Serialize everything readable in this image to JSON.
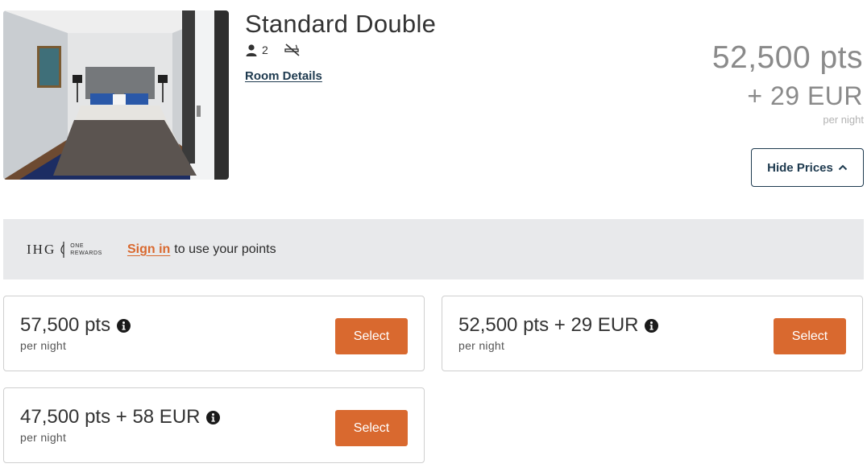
{
  "room": {
    "title": "Standard Double",
    "occupancy": "2",
    "details_link": "Room Details"
  },
  "price": {
    "points": "52,500 pts",
    "cash": "+ 29 EUR",
    "per_night": "per night"
  },
  "hide_prices_label": "Hide Prices",
  "banner": {
    "logo_text": "IHG",
    "logo_one": "ONE",
    "logo_rewards": "REWARDS",
    "signin_label": "Sign in",
    "rest_text": "to use your points"
  },
  "rates": [
    {
      "amount": "57,500 pts",
      "per_night": "per night",
      "select_label": "Select"
    },
    {
      "amount": "52,500 pts + 29 EUR",
      "per_night": "per night",
      "select_label": "Select"
    },
    {
      "amount": "47,500 pts + 58 EUR",
      "per_night": "per night",
      "select_label": "Select"
    }
  ],
  "icons": {
    "occupancy": "person-icon",
    "non_smoking": "no-smoking-icon",
    "hide_prices": "chevron-up-icon",
    "info": "info-icon",
    "logo": "ihg-flame-icon"
  },
  "colors": {
    "accent": "#d9692f",
    "navy": "#1e3a4f",
    "banner_bg": "#e8e9eb",
    "price_grey": "#8a8a8a"
  }
}
